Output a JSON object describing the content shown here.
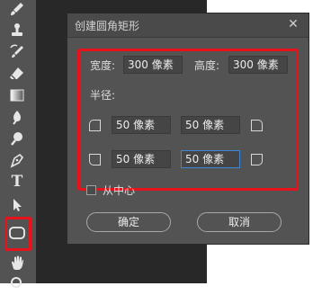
{
  "toolbar": {
    "tools": [
      {
        "name": "brush-tool",
        "icon": "brush-icon"
      },
      {
        "name": "stamp-tool",
        "icon": "stamp-icon"
      },
      {
        "name": "history-brush-tool",
        "icon": "history-brush-icon"
      },
      {
        "name": "eraser-tool",
        "icon": "eraser-icon"
      },
      {
        "name": "gradient-tool",
        "icon": "gradient-icon"
      },
      {
        "name": "blur-tool",
        "icon": "blur-icon"
      },
      {
        "name": "dodge-tool",
        "icon": "dodge-icon"
      },
      {
        "name": "pen-tool",
        "icon": "pen-icon"
      },
      {
        "name": "type-tool",
        "icon": "type-icon"
      },
      {
        "name": "path-selection-tool",
        "icon": "arrow-icon"
      },
      {
        "name": "rounded-rectangle-tool",
        "icon": "rounded-rectangle-icon",
        "active": true
      },
      {
        "name": "hand-tool",
        "icon": "hand-icon"
      },
      {
        "name": "zoom-tool",
        "icon": "zoom-icon"
      }
    ],
    "type_glyph": "T",
    "highlight_color": "#e8121b"
  },
  "dialog": {
    "title": "创建圆角矩形",
    "close_glyph": "✕",
    "width_label": "宽度:",
    "width_value": "300 像素",
    "height_label": "高度:",
    "height_value": "300 像素",
    "radius_label": "半径:",
    "radius_top_left": "50 像素",
    "radius_top_right": "50 像素",
    "radius_bottom_left": "50 像素",
    "radius_bottom_right": "50 像素",
    "from_center_label": "从中心",
    "from_center_checked": false,
    "ok_label": "确定",
    "cancel_label": "取消",
    "focus_color": "#3f86d8",
    "highlight_color": "#e8121b"
  }
}
